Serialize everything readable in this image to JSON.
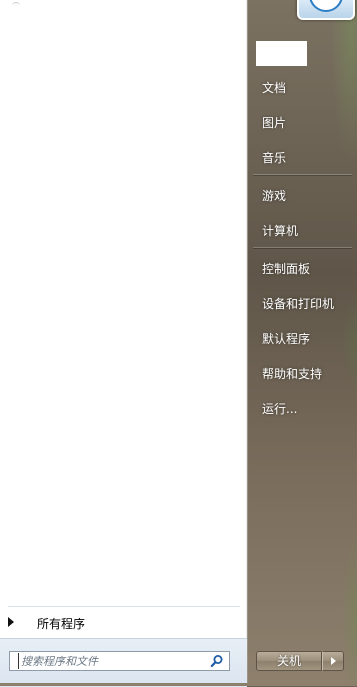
{
  "right_menu": {
    "items": [
      {
        "label": "文档"
      },
      {
        "label": "图片"
      },
      {
        "label": "音乐"
      },
      {
        "label": "游戏"
      },
      {
        "label": "计算机"
      },
      {
        "label": "控制面板"
      },
      {
        "label": "设备和打印机"
      },
      {
        "label": "默认程序"
      },
      {
        "label": "帮助和支持"
      },
      {
        "label": "运行..."
      }
    ]
  },
  "left_panel": {
    "all_programs_label": "所有程序",
    "search_placeholder": "搜索程序和文件"
  },
  "shutdown": {
    "label": "关机"
  },
  "icons": {
    "search": "search-icon",
    "all_programs_arrow": "triangle-right-icon",
    "shutdown_options": "triangle-right-icon"
  }
}
